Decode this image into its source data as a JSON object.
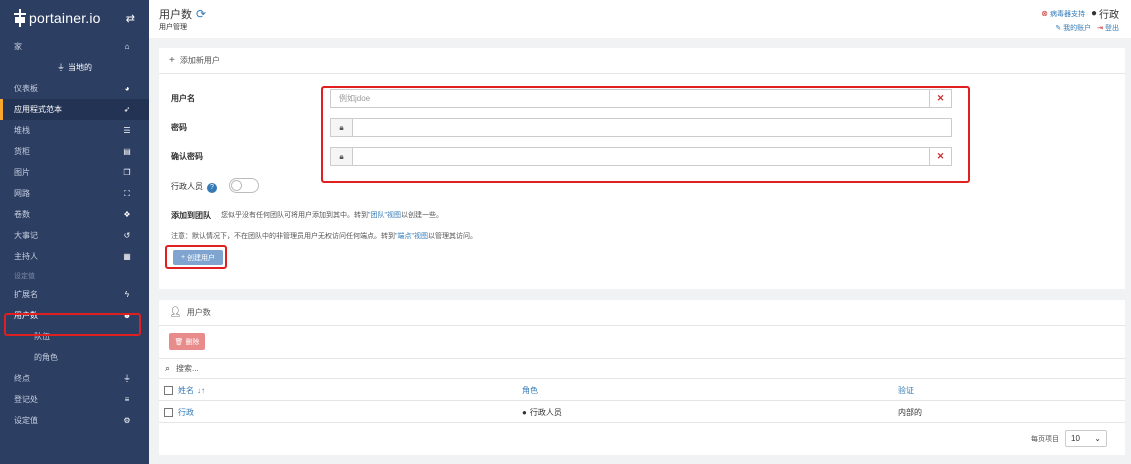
{
  "app": {
    "logo_text": "portainer.io",
    "swap_icon": "exchange-icon"
  },
  "sidebar": {
    "home": {
      "label": "家",
      "icon": "home-icon"
    },
    "environment": "当地的",
    "items": [
      {
        "label": "仪表板",
        "icon": "dashboard-icon"
      },
      {
        "label": "应用程式范本",
        "icon": "rocket-icon"
      },
      {
        "label": "堆栈",
        "icon": "list-icon"
      },
      {
        "label": "货柜",
        "icon": "server-icon"
      },
      {
        "label": "图片",
        "icon": "clone-icon"
      },
      {
        "label": "网路",
        "icon": "sitemap-icon"
      },
      {
        "label": "卷数",
        "icon": "cubes-icon"
      },
      {
        "label": "大事记",
        "icon": "history-icon"
      },
      {
        "label": "主持人",
        "icon": "th-icon"
      }
    ],
    "section_settings": "设定值",
    "settings_items": [
      {
        "label": "扩展名",
        "icon": "bolt-icon"
      },
      {
        "label": "用户数",
        "icon": "users-icon"
      }
    ],
    "sub_items": [
      "队伍",
      "的角色"
    ],
    "bottom_items": [
      {
        "label": "终点",
        "icon": "plug-icon"
      },
      {
        "label": "登记处",
        "icon": "database-icon"
      },
      {
        "label": "设定值",
        "icon": "cogs-icon"
      }
    ]
  },
  "header": {
    "title": "用户数",
    "breadcrumb": "用户管理",
    "support": "病毒器支持",
    "user": "行政",
    "my_account": "我的账户",
    "logout": "登出"
  },
  "add_user": {
    "panel_title": "添加新用户",
    "username_label": "用户名",
    "username_placeholder": "例如jdoe",
    "password_label": "密码",
    "confirm_label": "确认密码",
    "admin_label": "行政人员",
    "admin_enabled": false,
    "team_label": "添加到团队",
    "team_note_prefix": "您似乎没有任何团队可将用户添加到其中。转到",
    "team_note_link": "\"团队\"视图",
    "team_note_suffix": "以创建一些。",
    "note2_prefix": "注意：默认情况下，不在团队中的非管理员用户无权访问任何端点。转到",
    "note2_link": "\"端点\"视图",
    "note2_suffix": "以管理其访问。",
    "create_button": "创建用户"
  },
  "users": {
    "panel_title": "用户数",
    "delete_button": "删除",
    "search_placeholder": "搜索...",
    "columns": [
      "姓名",
      "角色",
      "验证"
    ],
    "sort_icon": "↓↑",
    "rows": [
      {
        "name": "行政",
        "role": "行政人员",
        "auth": "内部的"
      }
    ],
    "page_label": "每页项目",
    "page_size": "10"
  }
}
